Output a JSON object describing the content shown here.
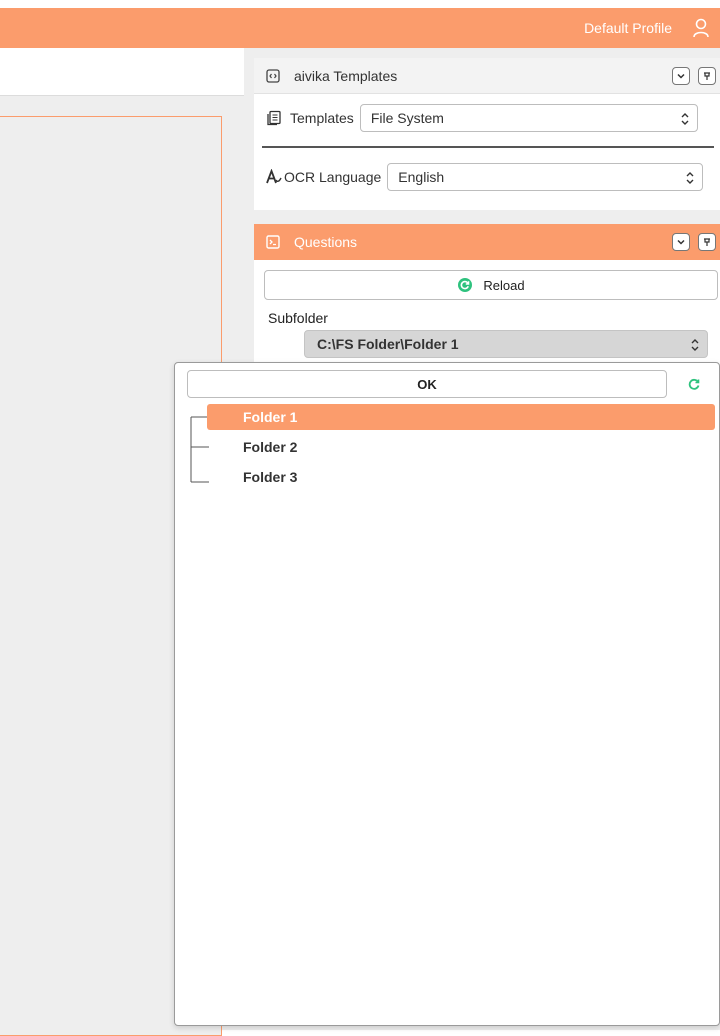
{
  "header": {
    "profile_label": "Default Profile",
    "user_icon": "user-icon",
    "accent_color": "#fb9c6c"
  },
  "templates_panel": {
    "title": "aivika Templates",
    "templates_label": "Templates",
    "templates_value": "File System",
    "ocr_label": "OCR Language",
    "ocr_value": "English"
  },
  "questions_panel": {
    "title": "Questions",
    "reload_label": "Reload",
    "subfolder_label": "Subfolder",
    "subfolder_value": "C:\\FS Folder\\Folder 1"
  },
  "dropdown": {
    "ok_label": "OK",
    "folders": [
      {
        "label": "Folder 1",
        "selected": true
      },
      {
        "label": "Folder 2",
        "selected": false
      },
      {
        "label": "Folder 3",
        "selected": false
      }
    ]
  }
}
